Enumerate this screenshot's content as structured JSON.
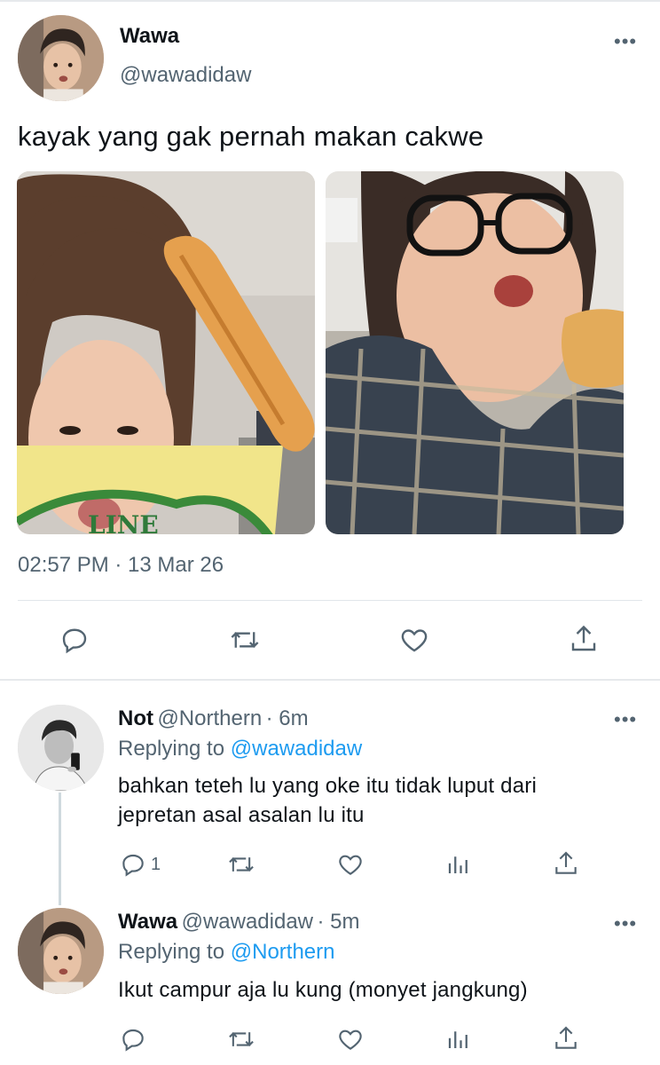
{
  "main_tweet": {
    "author_name": "Wawa",
    "author_handle": "@wawadidaw",
    "text": "kayak yang gak pernah makan cakwe",
    "timestamp": "02:57 PM · 13 Mar 26",
    "shirt_text": "LINE",
    "icons": [
      "reply-icon",
      "retweet-icon",
      "like-icon",
      "share-icon",
      "more-icon"
    ]
  },
  "replies": [
    {
      "author_name": "Not",
      "author_handle": "@Northern",
      "age": "· 6m",
      "replying_prefix": "Replying to",
      "replying_to": "@wawadidaw",
      "text_line1": "bahkan teteh lu yang oke itu tidak luput dari",
      "text_line2": "jepretan asal asalan lu itu",
      "reply_count": "1"
    },
    {
      "author_name": "Wawa",
      "author_handle": "@wawadidaw",
      "age": "· 5m",
      "replying_prefix": "Replying to",
      "replying_to": "@Northern",
      "text_line1": "Ikut campur aja lu kung (monyet jangkung)"
    }
  ],
  "colors": {
    "link": "#1d9bf0",
    "secondary_text": "#536471",
    "primary_text": "#0f1419",
    "divider": "#e1e6ea"
  }
}
